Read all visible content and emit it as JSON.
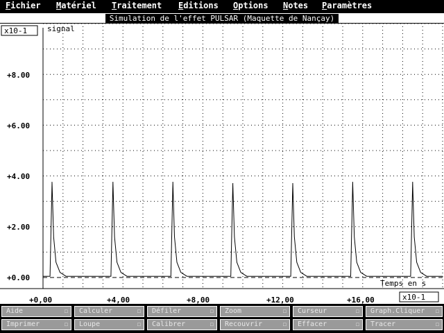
{
  "menu": [
    {
      "first": "F",
      "rest": "ichier"
    },
    {
      "first": "M",
      "rest": "atériel"
    },
    {
      "first": "T",
      "rest": "raitement"
    },
    {
      "first": "E",
      "rest": "ditions"
    },
    {
      "first": "O",
      "rest": "ptions"
    },
    {
      "first": "N",
      "rest": "otes"
    },
    {
      "first": "P",
      "rest": "aramètres"
    }
  ],
  "window": {
    "title": "Simulation de l'effet PULSAR (Maquette de Nançay)"
  },
  "plot": {
    "y_scale_label": "x10-1",
    "y_axis_label": "signal",
    "x_axis_label": "Temps en s",
    "x_scale_label": "x10-1",
    "y_ticks": [
      "+0.00",
      "+2.00",
      "+4.00",
      "+6.00",
      "+8.00"
    ],
    "x_ticks": [
      "+0,00",
      "+4,00",
      "+8,00",
      "+12,00",
      "+16,00"
    ]
  },
  "chart_data": {
    "type": "line",
    "title": "Simulation de l'effet PULSAR (Maquette de Nançay)",
    "xlabel": "Temps en s",
    "ylabel": "signal",
    "x_unit_multiplier": "x10-1",
    "y_unit_multiplier": "x10-1",
    "xlim": [
      0,
      20
    ],
    "ylim": [
      0,
      10
    ],
    "grid": true,
    "baseline": 0.05,
    "series": [
      {
        "peaks": [
          {
            "x": 0.45,
            "y": 3.75
          },
          {
            "x": 3.5,
            "y": 3.75
          },
          {
            "x": 6.5,
            "y": 3.75
          },
          {
            "x": 9.5,
            "y": 3.7
          },
          {
            "x": 12.5,
            "y": 3.7
          },
          {
            "x": 15.5,
            "y": 3.75
          },
          {
            "x": 18.5,
            "y": 3.75
          }
        ]
      }
    ]
  },
  "buttons": {
    "row1": [
      {
        "label": "Aide",
        "check": "☐"
      },
      {
        "label": "Calculer",
        "check": "☐"
      },
      {
        "label": "Défiler",
        "check": "☐"
      },
      {
        "label": "Zoom",
        "check": "☐"
      },
      {
        "label": "Curseur",
        "check": "☐"
      },
      {
        "label": "Graph.Cliquer",
        "check": "☐"
      }
    ],
    "row2": [
      {
        "label": "Imprimer",
        "check": "☐"
      },
      {
        "label": "Loupe",
        "check": "☐"
      },
      {
        "label": "Calibrer",
        "check": "☐"
      },
      {
        "label": "Recouvrir",
        "check": "☐"
      },
      {
        "label": "Effacer",
        "check": "☐"
      },
      {
        "label": "Tracer",
        "check": "☐"
      }
    ]
  }
}
